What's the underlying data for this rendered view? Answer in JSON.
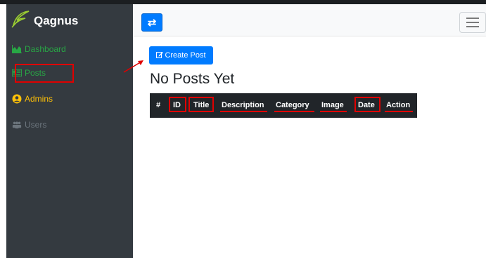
{
  "sidebar": {
    "brand": "Qagnus",
    "items": [
      {
        "label": "Dashboard"
      },
      {
        "label": "Posts"
      },
      {
        "label": "Admins"
      },
      {
        "label": "Users"
      }
    ]
  },
  "navbar": {
    "toggle_icon": "⇄"
  },
  "main": {
    "create_button": "Create Post",
    "heading": "No Posts Yet",
    "columns": [
      "#",
      "ID",
      "Title",
      "Description",
      "Category",
      "Image",
      "Date",
      "Action"
    ]
  },
  "colors": {
    "sidebar_bg": "#343a40",
    "primary": "#007bff",
    "success": "#28a745",
    "warning": "#ffc107",
    "muted": "#6c757d",
    "annotation": "#e00000"
  },
  "icons": {
    "brand": "feather-icon",
    "dashboard": "chart-area-icon",
    "posts": "newspaper-icon",
    "admins": "user-circle-icon",
    "users": "users-icon",
    "toggle": "exchange-icon",
    "menu": "hamburger-icon",
    "create": "edit-icon"
  }
}
